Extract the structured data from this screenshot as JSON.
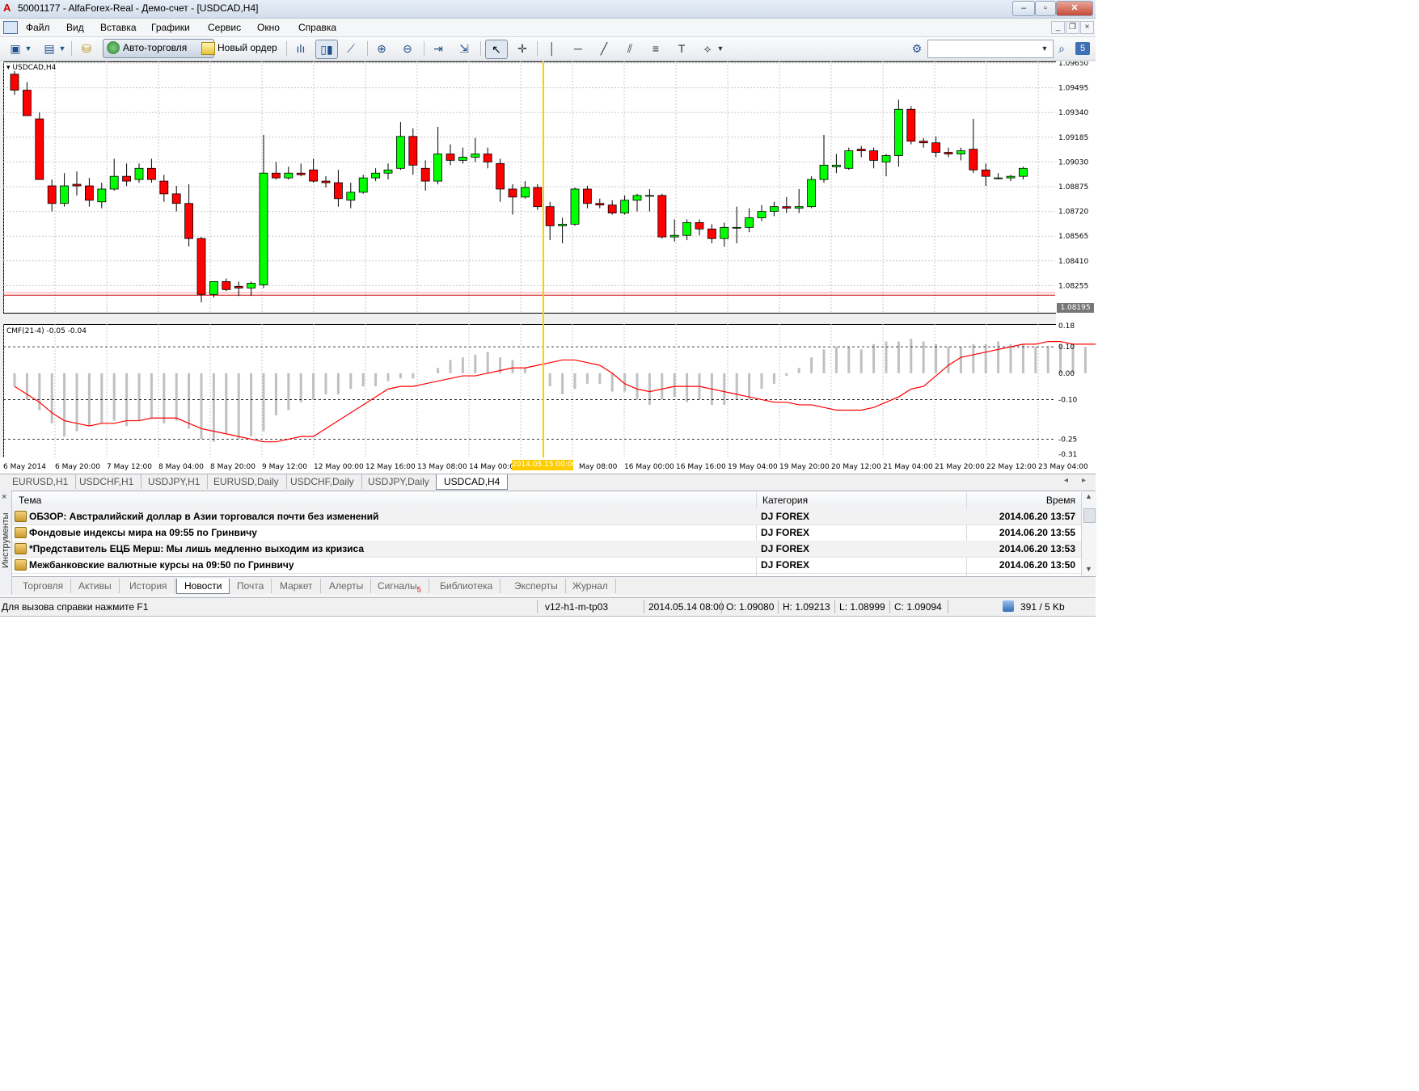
{
  "window": {
    "title": "50001177 - AlfaForex-Real - Демо-счет - [USDCAD,H4]",
    "logo": "A",
    "minimize": "–",
    "restore": "▫",
    "close": "✕"
  },
  "menu": [
    "Файл",
    "Вид",
    "Вставка",
    "Графики",
    "Сервис",
    "Окно",
    "Справка"
  ],
  "toolbar": {
    "auto_trading_label": "Авто-торговля",
    "new_order_label": "Новый ордер",
    "search_placeholder": "",
    "right_badge": "5"
  },
  "chart": {
    "symbol_label": "USDCAD,H4",
    "indicator_label": "CMF(21-4) -0.05 -0.04",
    "current_price": "1.08195",
    "highlight_time": "2014.05.15 00:00",
    "colors": {
      "bull": "#00ff00",
      "bear": "#ff0000",
      "cursor": "#ffcc00",
      "cmf": "#ff0000",
      "hist": "#c0c0c0"
    }
  },
  "chart_data": [
    {
      "type": "candlestick",
      "symbol": "USDCAD",
      "timeframe": "H4",
      "ylim": [
        1.081,
        1.0965
      ],
      "price_ticks": [
        "1.09650",
        "1.09495",
        "1.09340",
        "1.09185",
        "1.09030",
        "1.08875",
        "1.08720",
        "1.08565",
        "1.08410",
        "1.08255",
        "1.08195"
      ],
      "x_tick_labels": [
        "6 May 2014",
        "6 May 20:00",
        "7 May 12:00",
        "8 May 04:00",
        "8 May 20:00",
        "9 May 12:00",
        "12 May 00:00",
        "12 May 16:00",
        "13 May 08:00",
        "14 May 00:00",
        "2014.05.15 00:00",
        "May 08:00",
        "16 May 00:00",
        "16 May 16:00",
        "19 May 04:00",
        "19 May 20:00",
        "20 May 12:00",
        "21 May 04:00",
        "21 May 20:00",
        "22 May 12:00",
        "23 May 04:00"
      ],
      "horizontal_line": 1.08195,
      "ohlc": [
        [
          1.0958,
          1.096,
          1.0945,
          1.0948
        ],
        [
          1.0948,
          1.0953,
          1.0935,
          1.0932
        ],
        [
          1.093,
          1.0934,
          1.0892,
          1.0892
        ],
        [
          1.0888,
          1.0892,
          1.0872,
          1.0877
        ],
        [
          1.0877,
          1.0896,
          1.0875,
          1.0888
        ],
        [
          1.0889,
          1.0897,
          1.0882,
          1.0888
        ],
        [
          1.0888,
          1.0893,
          1.0875,
          1.0879
        ],
        [
          1.0878,
          1.089,
          1.0874,
          1.0886
        ],
        [
          1.0886,
          1.0905,
          1.0885,
          1.0894
        ],
        [
          1.0894,
          1.0902,
          1.0888,
          1.0891
        ],
        [
          1.0892,
          1.0902,
          1.089,
          1.0899
        ],
        [
          1.0899,
          1.0905,
          1.089,
          1.0892
        ],
        [
          1.0891,
          1.0895,
          1.0878,
          1.0883
        ],
        [
          1.0883,
          1.0888,
          1.0872,
          1.0877
        ],
        [
          1.0877,
          1.0889,
          1.085,
          1.0855
        ],
        [
          1.0855,
          1.0856,
          1.0815,
          1.082
        ],
        [
          1.082,
          1.0828,
          1.0818,
          1.0828
        ],
        [
          1.0828,
          1.083,
          1.0822,
          1.0823
        ],
        [
          1.0825,
          1.0828,
          1.0819,
          1.0824
        ],
        [
          1.0824,
          1.0828,
          1.0819,
          1.0827
        ],
        [
          1.0826,
          1.092,
          1.0824,
          1.0896
        ],
        [
          1.0896,
          1.0903,
          1.0892,
          1.0893
        ],
        [
          1.0893,
          1.09,
          1.0892,
          1.0896
        ],
        [
          1.0896,
          1.0902,
          1.0894,
          1.0895
        ],
        [
          1.0898,
          1.0905,
          1.089,
          1.0891
        ],
        [
          1.0891,
          1.0894,
          1.0887,
          1.089
        ],
        [
          1.089,
          1.0898,
          1.0875,
          1.088
        ],
        [
          1.0879,
          1.089,
          1.0874,
          1.0884
        ],
        [
          1.0884,
          1.0895,
          1.0883,
          1.0893
        ],
        [
          1.0893,
          1.0899,
          1.0891,
          1.0896
        ],
        [
          1.0896,
          1.0902,
          1.0892,
          1.0898
        ],
        [
          1.0899,
          1.0928,
          1.0898,
          1.0919
        ],
        [
          1.0919,
          1.0924,
          1.0895,
          1.0901
        ],
        [
          1.0899,
          1.0904,
          1.0885,
          1.0891
        ],
        [
          1.0891,
          1.0925,
          1.0889,
          1.0908
        ],
        [
          1.0908,
          1.0914,
          1.0901,
          1.0904
        ],
        [
          1.0904,
          1.0912,
          1.0902,
          1.0906
        ],
        [
          1.0906,
          1.0918,
          1.0903,
          1.0908
        ],
        [
          1.0908,
          1.0912,
          1.0899,
          1.0903
        ],
        [
          1.0902,
          1.0905,
          1.0878,
          1.0886
        ],
        [
          1.0886,
          1.0889,
          1.087,
          1.0881
        ],
        [
          1.0881,
          1.0891,
          1.088,
          1.0887
        ],
        [
          1.0887,
          1.0889,
          1.0873,
          1.0875
        ],
        [
          1.0875,
          1.0878,
          1.0854,
          1.0863
        ],
        [
          1.0863,
          1.0868,
          1.0852,
          1.0864
        ],
        [
          1.0864,
          1.0887,
          1.0863,
          1.0886
        ],
        [
          1.0886,
          1.0888,
          1.0874,
          1.0877
        ],
        [
          1.0877,
          1.088,
          1.0874,
          1.0876
        ],
        [
          1.0876,
          1.0879,
          1.087,
          1.0871
        ],
        [
          1.0871,
          1.0882,
          1.087,
          1.0879
        ],
        [
          1.0879,
          1.0883,
          1.0872,
          1.0882
        ],
        [
          1.0882,
          1.0886,
          1.0872,
          1.0882
        ],
        [
          1.0882,
          1.0883,
          1.0855,
          1.0856
        ],
        [
          1.0856,
          1.0867,
          1.0853,
          1.0857
        ],
        [
          1.0857,
          1.0867,
          1.0854,
          1.0865
        ],
        [
          1.0865,
          1.0867,
          1.0857,
          1.0861
        ],
        [
          1.0861,
          1.0864,
          1.0852,
          1.0855
        ],
        [
          1.0855,
          1.0865,
          1.085,
          1.0862
        ],
        [
          1.0862,
          1.0875,
          1.0852,
          1.0862
        ],
        [
          1.0862,
          1.0874,
          1.0859,
          1.0868
        ],
        [
          1.0868,
          1.0876,
          1.0866,
          1.0872
        ],
        [
          1.0872,
          1.0878,
          1.0869,
          1.0875
        ],
        [
          1.0875,
          1.0881,
          1.0871,
          1.0874
        ],
        [
          1.0874,
          1.0886,
          1.0871,
          1.0875
        ],
        [
          1.0875,
          1.0894,
          1.0874,
          1.0892
        ],
        [
          1.0892,
          1.092,
          1.089,
          1.0901
        ],
        [
          1.09,
          1.0908,
          1.0896,
          1.0901
        ],
        [
          1.0899,
          1.0912,
          1.0898,
          1.091
        ],
        [
          1.0911,
          1.0913,
          1.0906,
          1.091
        ],
        [
          1.091,
          1.0912,
          1.0899,
          1.0904
        ],
        [
          1.0903,
          1.0908,
          1.0894,
          1.0907
        ],
        [
          1.0907,
          1.0942,
          1.09,
          1.0936
        ],
        [
          1.0936,
          1.0938,
          1.0914,
          1.0916
        ],
        [
          1.0916,
          1.0918,
          1.0912,
          1.0915
        ],
        [
          1.0915,
          1.0919,
          1.0906,
          1.0909
        ],
        [
          1.0909,
          1.0912,
          1.0906,
          1.0908
        ],
        [
          1.0908,
          1.0912,
          1.0904,
          1.091
        ],
        [
          1.0911,
          1.093,
          1.0896,
          1.0898
        ],
        [
          1.0898,
          1.0902,
          1.0888,
          1.0894
        ],
        [
          1.0893,
          1.0896,
          1.0892,
          1.0893
        ],
        [
          1.0893,
          1.0895,
          1.0891,
          1.0894
        ],
        [
          1.0894,
          1.09,
          1.0892,
          1.0899
        ]
      ]
    },
    {
      "type": "line",
      "name": "CMF(21-4)",
      "ylim": [
        -0.31,
        0.18
      ],
      "y_ticks": [
        "0.18",
        "0.10",
        "0.00",
        "-0.10",
        "-0.25",
        "-0.31"
      ],
      "levels": [
        0.1,
        -0.1,
        -0.25
      ],
      "signal": [
        -0.05,
        -0.08,
        -0.11,
        -0.15,
        -0.18,
        -0.19,
        -0.2,
        -0.19,
        -0.19,
        -0.18,
        -0.18,
        -0.17,
        -0.17,
        -0.17,
        -0.19,
        -0.21,
        -0.22,
        -0.23,
        -0.24,
        -0.25,
        -0.26,
        -0.26,
        -0.25,
        -0.24,
        -0.24,
        -0.21,
        -0.18,
        -0.15,
        -0.12,
        -0.09,
        -0.06,
        -0.05,
        -0.05,
        -0.04,
        -0.03,
        -0.02,
        -0.01,
        -0.01,
        0.0,
        0.01,
        0.02,
        0.02,
        0.03,
        0.04,
        0.05,
        0.05,
        0.04,
        0.03,
        0.0,
        -0.04,
        -0.06,
        -0.07,
        -0.06,
        -0.05,
        -0.05,
        -0.05,
        -0.06,
        -0.07,
        -0.08,
        -0.09,
        -0.1,
        -0.11,
        -0.11,
        -0.12,
        -0.12,
        -0.13,
        -0.14,
        -0.14,
        -0.14,
        -0.13,
        -0.11,
        -0.09,
        -0.06,
        -0.05,
        -0.01,
        0.03,
        0.06,
        0.07,
        0.08,
        0.09,
        0.1,
        0.11,
        0.11,
        0.12,
        0.12,
        0.11,
        0.11,
        0.11,
        0.11,
        0.11,
        0.11,
        0.1,
        0.1
      ],
      "histogram": [
        -0.05,
        -0.1,
        -0.14,
        -0.19,
        -0.24,
        -0.22,
        -0.2,
        -0.19,
        -0.18,
        -0.2,
        -0.18,
        -0.17,
        -0.19,
        -0.18,
        -0.21,
        -0.25,
        -0.26,
        -0.23,
        -0.25,
        -0.24,
        -0.22,
        -0.16,
        -0.14,
        -0.11,
        -0.1,
        -0.08,
        -0.08,
        -0.06,
        -0.05,
        -0.05,
        -0.03,
        -0.02,
        -0.02,
        0.0,
        0.02,
        0.05,
        0.06,
        0.07,
        0.08,
        0.06,
        0.05,
        0.02,
        0.0,
        -0.05,
        -0.08,
        -0.06,
        -0.04,
        -0.04,
        -0.07,
        -0.07,
        -0.1,
        -0.12,
        -0.1,
        -0.09,
        -0.11,
        -0.1,
        -0.12,
        -0.12,
        -0.1,
        -0.1,
        -0.06,
        -0.04,
        -0.01,
        0.02,
        0.06,
        0.09,
        0.1,
        0.1,
        0.09,
        0.11,
        0.12,
        0.12,
        0.13,
        0.12,
        0.11,
        0.1,
        0.1,
        0.11,
        0.11,
        0.12,
        0.11,
        0.11,
        0.1,
        0.1,
        0.11,
        0.11,
        0.1,
        0.09,
        0.1,
        0.1
      ]
    }
  ],
  "chart_tabs": [
    "EURUSD,H1",
    "USDCHF,H1",
    "USDJPY,H1",
    "EURUSD,Daily",
    "USDCHF,Daily",
    "USDJPY,Daily",
    "USDCAD,H4"
  ],
  "chart_tabs_active": 6,
  "terminal": {
    "side_label": "Инструменты",
    "columns": {
      "topic": "Тема",
      "category": "Категория",
      "time": "Время"
    },
    "news": [
      {
        "title": "ОБЗОР: Австралийский доллар в Азии торговался почти без изменений",
        "category": "DJ FOREX",
        "time": "2014.06.20 13:57"
      },
      {
        "title": "Фондовые индексы мира на 09:55 по Гринвичу",
        "category": "DJ FOREX",
        "time": "2014.06.20 13:55"
      },
      {
        "title": "*Представитель ЕЦБ Мерш: Мы лишь медленно выходим из кризиса",
        "category": "DJ FOREX",
        "time": "2014.06.20 13:53"
      },
      {
        "title": "Межбанковские валютные курсы на 09:50 по Гринвичу",
        "category": "DJ FOREX",
        "time": "2014.06.20 13:50"
      }
    ],
    "tabs": [
      "Торговля",
      "Активы",
      "История",
      "Новости",
      "Почта",
      "Маркет",
      "Алерты",
      "Сигналы",
      "Библиотека",
      "Эксперты",
      "Журнал"
    ],
    "tabs_active": 3,
    "signals_badge": "5"
  },
  "status": {
    "help": "Для вызова справки нажмите F1",
    "profile": "v12-h1-m-tp03",
    "datetime": "2014.05.14 08:00",
    "open": "O: 1.09080",
    "high": "H: 1.09213",
    "low": "L: 1.08999",
    "close": "C: 1.09094",
    "traffic": "391 / 5 Kb"
  }
}
